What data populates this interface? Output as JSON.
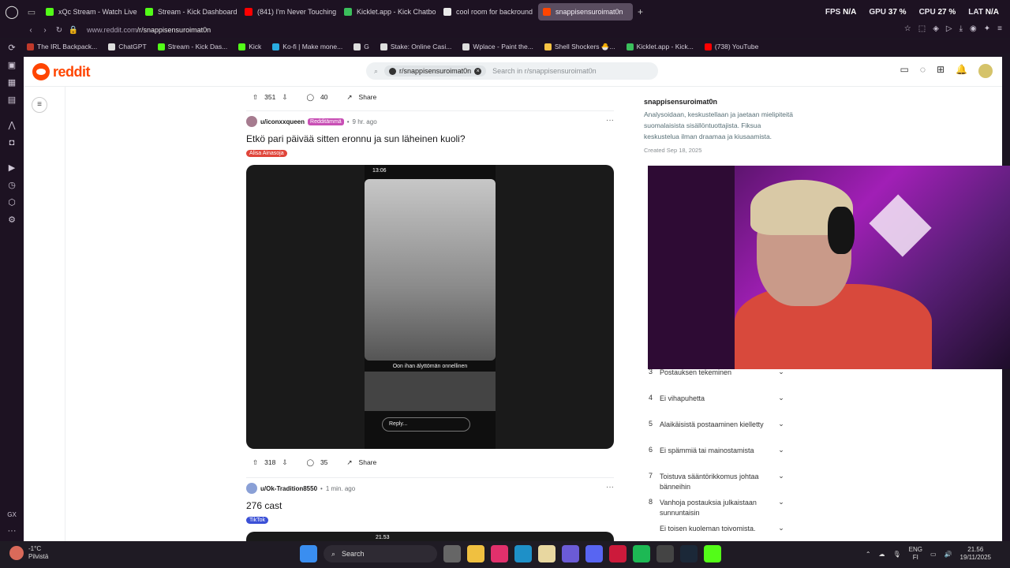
{
  "browser": {
    "tabs": [
      {
        "label": "xQc Stream - Watch Live",
        "color": "#53fc18",
        "active": false
      },
      {
        "label": "Stream - Kick Dashboard",
        "color": "#53fc18",
        "active": false
      },
      {
        "label": "(841) I'm Never Touching",
        "color": "#ff0000",
        "active": false
      },
      {
        "label": "Kicklet.app - Kick Chatbo",
        "color": "#3bbf5c",
        "active": false
      },
      {
        "label": "cool room for backround",
        "color": "#e9e9e9",
        "active": false
      },
      {
        "label": "snappisensuroimat0n",
        "color": "#ff4500",
        "active": true
      }
    ],
    "stats": {
      "fps_label": "FPS",
      "fps_value": "N/A",
      "gpu_label": "GPU",
      "gpu_value": "37 %",
      "cpu_label": "CPU",
      "cpu_value": "27 %",
      "lat_label": "LAT",
      "lat_value": "N/A"
    },
    "url_host": "www.reddit.com",
    "url_path": "/r/snappisensuroimat0n",
    "bookmarks": [
      {
        "label": "The IRL Backpack...",
        "color": "#c0392b"
      },
      {
        "label": "ChatGPT",
        "color": "#dddddd"
      },
      {
        "label": "Stream - Kick Das...",
        "color": "#53fc18"
      },
      {
        "label": "Kick",
        "color": "#53fc18"
      },
      {
        "label": "Ko-fi | Make mone...",
        "color": "#29abe0"
      },
      {
        "label": "G",
        "color": "#dddddd"
      },
      {
        "label": "Stake: Online Casi...",
        "color": "#dddddd"
      },
      {
        "label": "Wplace - Paint the...",
        "color": "#dddddd"
      },
      {
        "label": "Shell Shockers 🐣...",
        "color": "#f6c344"
      },
      {
        "label": "Kicklet.app - Kick...",
        "color": "#3bbf5c"
      },
      {
        "label": "(738) YouTube",
        "color": "#ff0000"
      }
    ]
  },
  "reddit": {
    "logo_text": "reddit",
    "search_chip": "r/snappisensuroimat0n",
    "search_placeholder": "Search in r/snappisensuroimat0n",
    "top_actions": {
      "votes": "351",
      "comments": "40",
      "share": "Share"
    },
    "post1": {
      "user": "u/iconxxqueen",
      "user_flair": "Redditämmä",
      "time": "9 hr. ago",
      "title": "Etkö pari päivää sitten eronnu ja sun läheinen kuoli?",
      "tag": "Alisa Ainasoja",
      "tag_color": "#e0453a",
      "media": {
        "status_time": "13:06",
        "caption": "Oon ihan älyttömän onnellinen",
        "reply": "Reply..."
      },
      "votes": "318",
      "comments": "35",
      "share": "Share"
    },
    "post2": {
      "user": "u/Ok-Tradition8550",
      "time": "1 min. ago",
      "title": "276 cast",
      "tag": "TikTok",
      "tag_color": "#3b50d6",
      "status_time": "21.53"
    },
    "sidebar": {
      "name": "snappisensuroimat0n",
      "description": "Analysoidaan, keskustellaan ja jaetaan mielipiteitä suomalaisista sisällöntuottajista. Fiksua keskustelua ilman draamaa ja kiusaamista.",
      "created": "Created Sep 18, 2025",
      "rules": [
        {
          "n": "3",
          "text": "Postauksen tekeminen"
        },
        {
          "n": "4",
          "text": "Ei vihapuhetta"
        },
        {
          "n": "5",
          "text": "Alaikäisistä postaaminen kielletty"
        },
        {
          "n": "6",
          "text": "Ei spämmiä tai mainostamista"
        },
        {
          "n": "7",
          "text": "Toistuva sääntörikkomus johtaa bänneihin"
        },
        {
          "n": "8",
          "text": "Vanhoja postauksia julkaistaan sunnuntaisin"
        },
        {
          "n": "",
          "text": "Ei toisen kuoleman toivomista."
        }
      ]
    }
  },
  "taskbar": {
    "weather_temp": "-1°C",
    "weather_desc": "Pilvistä",
    "search_label": "Search",
    "lang_top": "ENG",
    "lang_bottom": "FI",
    "time": "21.56",
    "date": "19/11/2025"
  }
}
